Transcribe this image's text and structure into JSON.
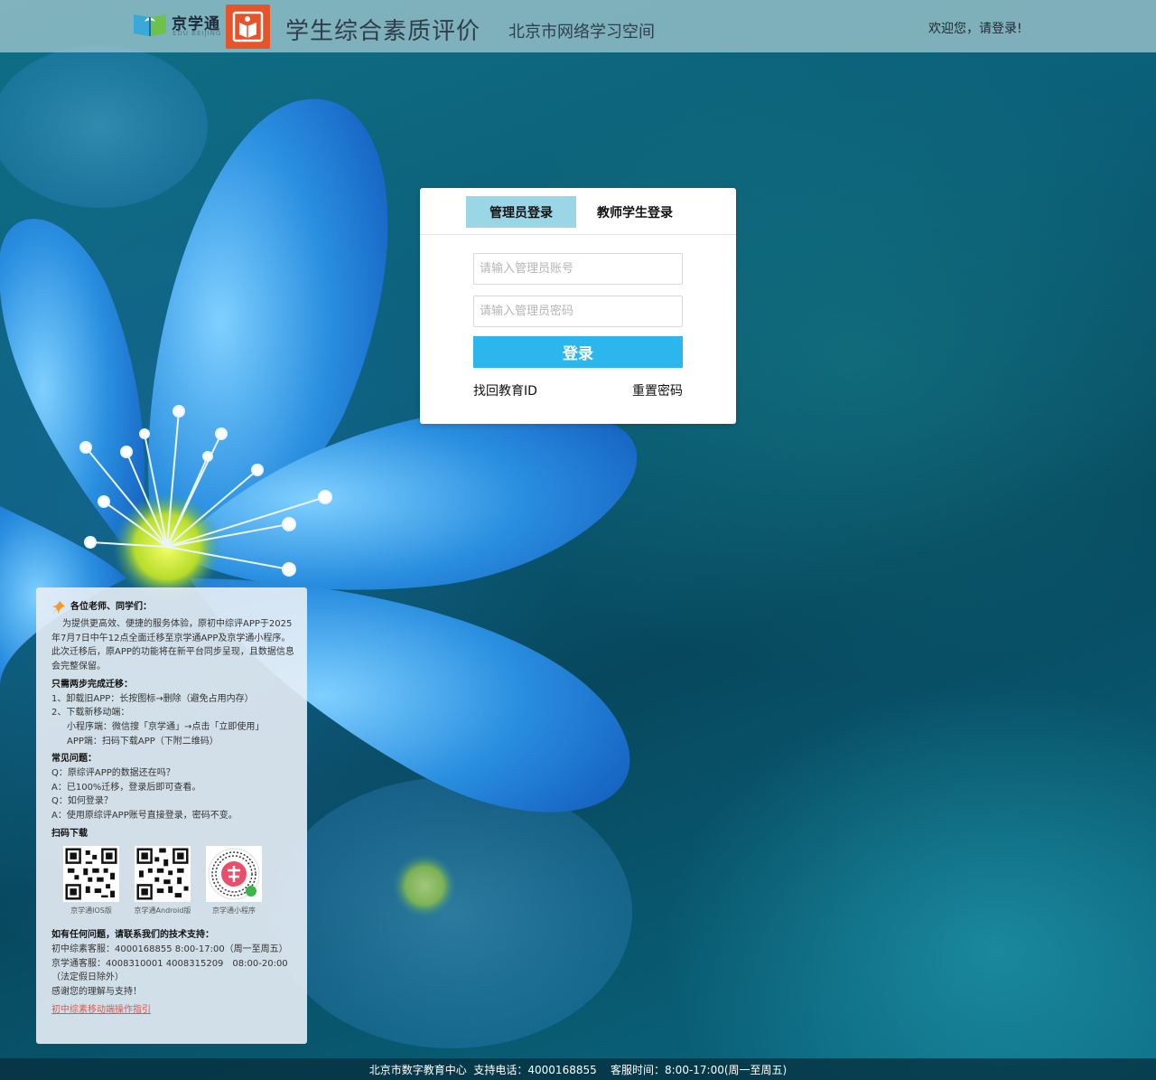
{
  "header": {
    "logo_text": "京学通",
    "logo_sub": "EDU BEIJING",
    "app_title": "学生综合素质评价",
    "app_subtitle": "北京市网络学习空间",
    "welcome": "欢迎您，请登录!"
  },
  "login": {
    "tabs": [
      {
        "label": "管理员登录",
        "active": true
      },
      {
        "label": "教师学生登录",
        "active": false
      }
    ],
    "account_placeholder": "请输入管理员账号",
    "password_placeholder": "请输入管理员密码",
    "submit_label": "登录",
    "find_id_label": "找回教育ID",
    "reset_password_label": "重置密码"
  },
  "notice": {
    "greeting": "各位老师、同学们：",
    "intro": "为提供更高效、便捷的服务体验，原初中综评APP于2025年7月7日中午12点全面迁移至京学通APP及京学通小程序。此次迁移后，原APP的功能将在新平台同步呈现，且数据信息会完整保留。",
    "steps_title": "只需两步完成迁移：",
    "steps": [
      "1、卸载旧APP：长按图标→删除（避免占用内存）",
      "2、下载新移动端："
    ],
    "sub_steps": [
      "小程序端：微信搜「京学通」→点击「立即使用」",
      "APP端：扫码下载APP（下附二维码）"
    ],
    "faq_title": "常见问题：",
    "faq": [
      "Q：原综评APP的数据还在吗？",
      "A：已100%迁移，登录后即可查看。",
      "Q：如何登录？",
      "A：使用原综评APP账号直接登录，密码不变。"
    ],
    "download_title": "扫码下载",
    "qr_codes": [
      {
        "caption": "京学通IOS版"
      },
      {
        "caption": "京学通Android版"
      },
      {
        "caption": "京学通小程序"
      }
    ],
    "support_title": "如有任何问题，请联系我们的技术支持：",
    "support_lines": [
      "初中综素客服：4000168855 8:00-17:00（周一至周五）",
      "京学通客服：4008310001 4008315209　08:00-20:00（法定假日除外）",
      "感谢您的理解与支持！"
    ],
    "guide_link": "初中综素移动端操作指引"
  },
  "footer": {
    "text": "北京市数字教育中心  支持电话：4000168855    客服时间：8:00-17:00(周一至周五)"
  },
  "colors": {
    "tab_active": "#9bd6e6",
    "login_button": "#2bb6ee",
    "badge": "#e5542a",
    "guide_link": "#e0574a"
  }
}
